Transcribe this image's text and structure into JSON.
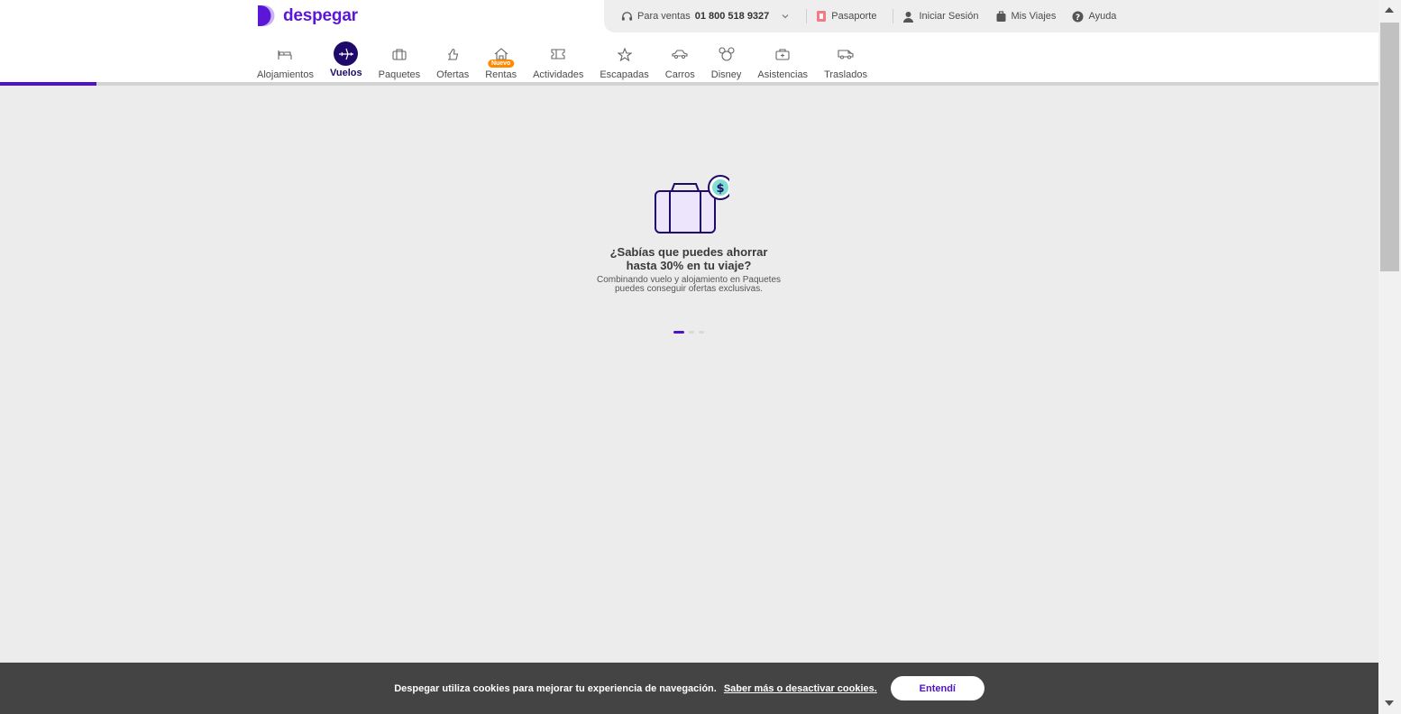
{
  "brand": {
    "name": "despegar",
    "color": "#5c16d8"
  },
  "topbar": {
    "sales_prefix": "Para ventas",
    "sales_phone": "01 800 518 9327",
    "passport": "Pasaporte",
    "login": "Iniciar Sesión",
    "trips": "Mis Viajes",
    "help": "Ayuda"
  },
  "nav": {
    "items": [
      {
        "label": "Alojamientos",
        "icon": "bed-icon"
      },
      {
        "label": "Vuelos",
        "icon": "plane-icon",
        "active": true
      },
      {
        "label": "Paquetes",
        "icon": "suitcase-icon"
      },
      {
        "label": "Ofertas",
        "icon": "thumbs-up-icon"
      },
      {
        "label": "Rentas",
        "icon": "house-icon",
        "badge": "Nuevo"
      },
      {
        "label": "Actividades",
        "icon": "ticket-icon"
      },
      {
        "label": "Escapadas",
        "icon": "star-icon"
      },
      {
        "label": "Carros",
        "icon": "car-icon"
      },
      {
        "label": "Disney",
        "icon": "mickey-icon"
      },
      {
        "label": "Asistencias",
        "icon": "medkit-icon"
      },
      {
        "label": "Traslados",
        "icon": "van-icon"
      }
    ]
  },
  "loading": {
    "progress_fraction": 0.07,
    "title_line1": "¿Sabías que puedes ahorrar",
    "title_line2": "hasta 30% en tu viaje?",
    "subtitle_line1": "Combinando vuelo y alojamiento en Paquetes",
    "subtitle_line2": "puedes conseguir ofertas exclusivas.",
    "carousel_active_index": 0,
    "carousel_count": 3
  },
  "cookie": {
    "text": "Despegar utiliza cookies para mejorar tu experiencia de navegación.",
    "link": "Saber más o desactivar cookies.",
    "button": "Entendí"
  },
  "colors": {
    "accent": "#4f12c9",
    "dark_accent": "#1f0a6b",
    "badge": "#ff8a00",
    "banner_bg": "#444444"
  }
}
